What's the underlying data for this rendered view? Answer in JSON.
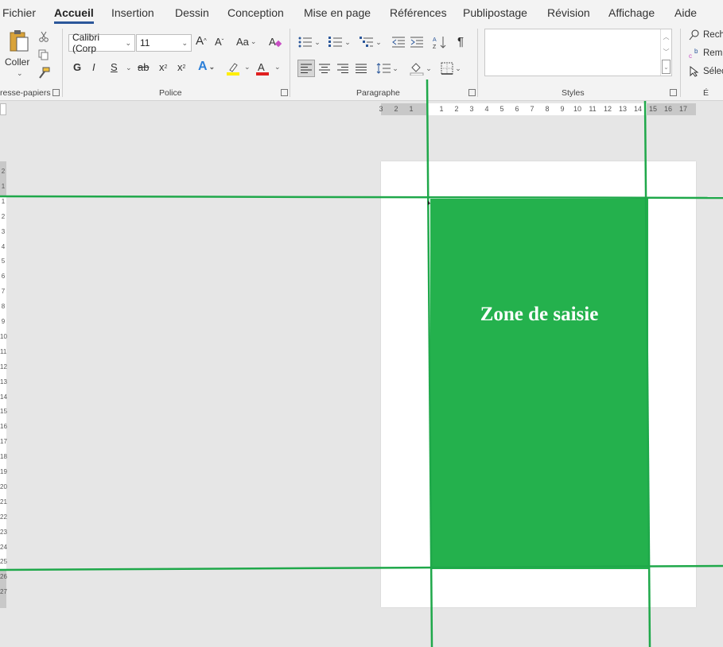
{
  "menu": {
    "tabs": [
      {
        "label": "Fichier"
      },
      {
        "label": "Accueil",
        "active": true
      },
      {
        "label": "Insertion"
      },
      {
        "label": "Dessin"
      },
      {
        "label": "Conception"
      },
      {
        "label": "Mise en page"
      },
      {
        "label": "Références"
      },
      {
        "label": "Publipostage"
      },
      {
        "label": "Révision"
      },
      {
        "label": "Affichage"
      },
      {
        "label": "Aide"
      }
    ]
  },
  "ribbon": {
    "clipboard": {
      "paste_label": "Coller",
      "group_label": "resse-papiers"
    },
    "font": {
      "font_name": "Calibri (Corp",
      "font_size": "11",
      "bold": "G",
      "italic": "I",
      "underline": "S",
      "strike": "ab",
      "subscript": "x",
      "superscript": "x",
      "case": "Aa",
      "grow": "A",
      "shrink": "A",
      "effects": "A",
      "color_letter": "A",
      "group_label": "Police"
    },
    "paragraph": {
      "pilcrow": "¶",
      "group_label": "Paragraphe"
    },
    "styles": {
      "group_label": "Styles"
    },
    "editing": {
      "find_label": "Rech",
      "replace_label": "Rem",
      "select_label": "Sélec",
      "group_label": "É"
    }
  },
  "ruler": {
    "h_ticks": [
      "3",
      "2",
      "1",
      "1",
      "2",
      "3",
      "4",
      "5",
      "6",
      "7",
      "8",
      "9",
      "10",
      "11",
      "12",
      "13",
      "14",
      "15",
      "16",
      "17"
    ],
    "v_ticks": [
      "2",
      "1",
      "1",
      "2",
      "3",
      "4",
      "5",
      "6",
      "7",
      "8",
      "9",
      "10",
      "11",
      "12",
      "13",
      "14",
      "15",
      "16",
      "17",
      "18",
      "19",
      "20",
      "21",
      "22",
      "23",
      "24",
      "25",
      "26",
      "27"
    ]
  },
  "document": {
    "zone_label": "Zone de saisie"
  },
  "colors": {
    "zone_fill": "#24b14d",
    "guide_line": "#1fa84a",
    "accent": "#2b579a"
  }
}
